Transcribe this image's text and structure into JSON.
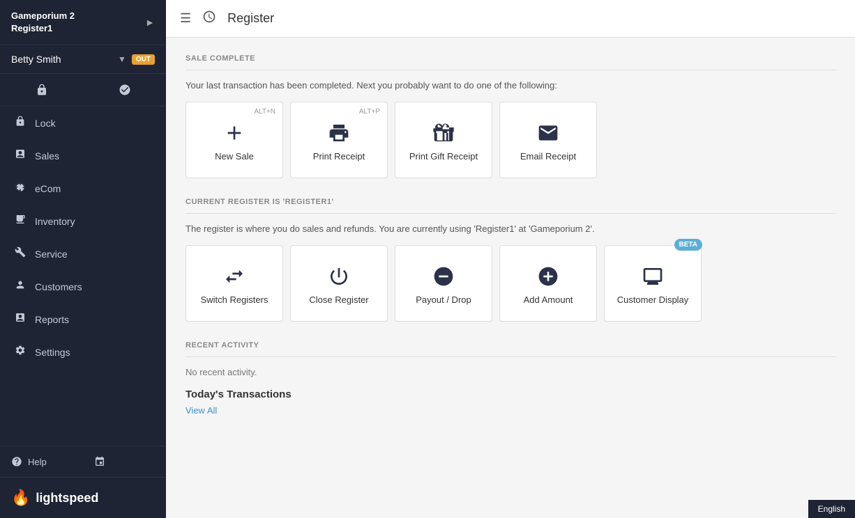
{
  "sidebar": {
    "app_name": "Gameporium 2",
    "register_name": "Register1",
    "user_name": "Betty Smith",
    "user_status": "OUT",
    "nav_items": [
      {
        "id": "lock",
        "label": "Lock",
        "icon": "lock"
      },
      {
        "id": "sales",
        "label": "Sales",
        "icon": "sales"
      },
      {
        "id": "ecom",
        "label": "eCom",
        "icon": "ecom"
      },
      {
        "id": "inventory",
        "label": "Inventory",
        "icon": "inventory"
      },
      {
        "id": "service",
        "label": "Service",
        "icon": "service"
      },
      {
        "id": "customers",
        "label": "Customers",
        "icon": "customers"
      },
      {
        "id": "reports",
        "label": "Reports",
        "icon": "reports"
      },
      {
        "id": "settings",
        "label": "Settings",
        "icon": "settings"
      }
    ],
    "help_label": "Help",
    "logo_text": "lightspeed"
  },
  "topbar": {
    "title": "Register"
  },
  "sale_complete": {
    "section_title": "SALE COMPLETE",
    "description": "Your last transaction has been completed. Next you probably want to do one of the following:",
    "cards": [
      {
        "id": "new-sale",
        "label": "New Sale",
        "shortcut": "ALT+N"
      },
      {
        "id": "print-receipt",
        "label": "Print Receipt",
        "shortcut": "ALT+P"
      },
      {
        "id": "print-gift-receipt",
        "label": "Print Gift Receipt",
        "shortcut": ""
      },
      {
        "id": "email-receipt",
        "label": "Email Receipt",
        "shortcut": ""
      }
    ]
  },
  "current_register": {
    "section_title": "CURRENT REGISTER IS 'REGISTER1'",
    "description": "The register is where you do sales and refunds. You are currently using 'Register1'  at 'Gameporium 2'.",
    "cards": [
      {
        "id": "switch-registers",
        "label": "Switch Registers",
        "beta": false
      },
      {
        "id": "close-register",
        "label": "Close Register",
        "beta": false
      },
      {
        "id": "payout-drop",
        "label": "Payout / Drop",
        "beta": false
      },
      {
        "id": "add-amount",
        "label": "Add Amount",
        "beta": false
      },
      {
        "id": "customer-display",
        "label": "Customer Display",
        "beta": true
      }
    ]
  },
  "recent_activity": {
    "section_title": "RECENT ACTIVITY",
    "no_activity_text": "No recent activity.",
    "today_transactions_title": "Today's Transactions",
    "view_all_label": "View All"
  },
  "footer": {
    "english_label": "English"
  }
}
